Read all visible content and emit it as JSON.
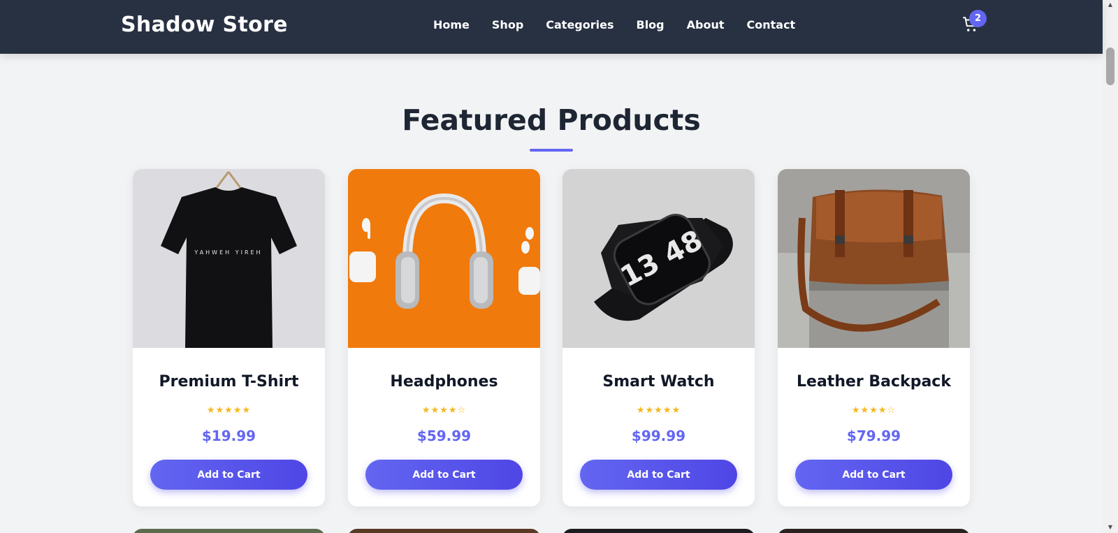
{
  "brand": "Shadow Store",
  "nav": {
    "items": [
      "Home",
      "Shop",
      "Categories",
      "Blog",
      "About",
      "Contact"
    ]
  },
  "cart": {
    "count": "2",
    "icon": "cart-icon"
  },
  "section": {
    "title": "Featured Products"
  },
  "products": [
    {
      "name": "Premium T-Shirt",
      "stars": "★★★★★",
      "rating": 5,
      "price": "$19.99",
      "button": "Add to Cart",
      "image_text": "YAHWEH YIREH"
    },
    {
      "name": "Headphones",
      "stars": "★★★★☆",
      "rating": 4,
      "price": "$59.99",
      "button": "Add to Cart"
    },
    {
      "name": "Smart Watch",
      "stars": "★★★★★",
      "rating": 5,
      "price": "$99.99",
      "button": "Add to Cart",
      "image_text": "13 48"
    },
    {
      "name": "Leather Backpack",
      "stars": "★★★★☆",
      "rating": 4,
      "price": "$79.99",
      "button": "Add to Cart"
    }
  ],
  "colors": {
    "nav_bg": "#273142",
    "accent": "#6366f1",
    "star": "#f5b71d",
    "page_bg": "#f2f3f5"
  }
}
